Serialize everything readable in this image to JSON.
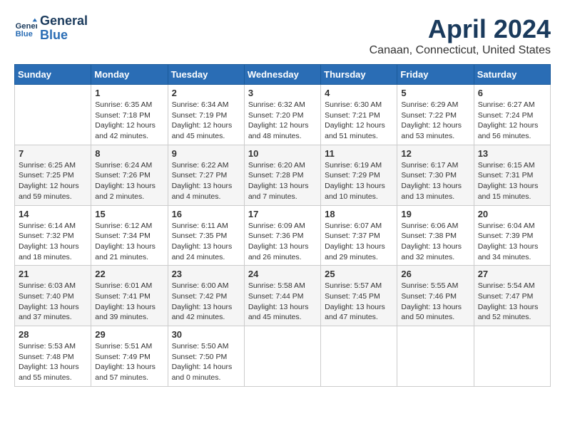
{
  "header": {
    "logo_line1": "General",
    "logo_line2": "Blue",
    "month": "April 2024",
    "location": "Canaan, Connecticut, United States"
  },
  "weekdays": [
    "Sunday",
    "Monday",
    "Tuesday",
    "Wednesday",
    "Thursday",
    "Friday",
    "Saturday"
  ],
  "weeks": [
    [
      {
        "day": "",
        "sunrise": "",
        "sunset": "",
        "daylight": ""
      },
      {
        "day": "1",
        "sunrise": "Sunrise: 6:35 AM",
        "sunset": "Sunset: 7:18 PM",
        "daylight": "Daylight: 12 hours and 42 minutes."
      },
      {
        "day": "2",
        "sunrise": "Sunrise: 6:34 AM",
        "sunset": "Sunset: 7:19 PM",
        "daylight": "Daylight: 12 hours and 45 minutes."
      },
      {
        "day": "3",
        "sunrise": "Sunrise: 6:32 AM",
        "sunset": "Sunset: 7:20 PM",
        "daylight": "Daylight: 12 hours and 48 minutes."
      },
      {
        "day": "4",
        "sunrise": "Sunrise: 6:30 AM",
        "sunset": "Sunset: 7:21 PM",
        "daylight": "Daylight: 12 hours and 51 minutes."
      },
      {
        "day": "5",
        "sunrise": "Sunrise: 6:29 AM",
        "sunset": "Sunset: 7:22 PM",
        "daylight": "Daylight: 12 hours and 53 minutes."
      },
      {
        "day": "6",
        "sunrise": "Sunrise: 6:27 AM",
        "sunset": "Sunset: 7:24 PM",
        "daylight": "Daylight: 12 hours and 56 minutes."
      }
    ],
    [
      {
        "day": "7",
        "sunrise": "Sunrise: 6:25 AM",
        "sunset": "Sunset: 7:25 PM",
        "daylight": "Daylight: 12 hours and 59 minutes."
      },
      {
        "day": "8",
        "sunrise": "Sunrise: 6:24 AM",
        "sunset": "Sunset: 7:26 PM",
        "daylight": "Daylight: 13 hours and 2 minutes."
      },
      {
        "day": "9",
        "sunrise": "Sunrise: 6:22 AM",
        "sunset": "Sunset: 7:27 PM",
        "daylight": "Daylight: 13 hours and 4 minutes."
      },
      {
        "day": "10",
        "sunrise": "Sunrise: 6:20 AM",
        "sunset": "Sunset: 7:28 PM",
        "daylight": "Daylight: 13 hours and 7 minutes."
      },
      {
        "day": "11",
        "sunrise": "Sunrise: 6:19 AM",
        "sunset": "Sunset: 7:29 PM",
        "daylight": "Daylight: 13 hours and 10 minutes."
      },
      {
        "day": "12",
        "sunrise": "Sunrise: 6:17 AM",
        "sunset": "Sunset: 7:30 PM",
        "daylight": "Daylight: 13 hours and 13 minutes."
      },
      {
        "day": "13",
        "sunrise": "Sunrise: 6:15 AM",
        "sunset": "Sunset: 7:31 PM",
        "daylight": "Daylight: 13 hours and 15 minutes."
      }
    ],
    [
      {
        "day": "14",
        "sunrise": "Sunrise: 6:14 AM",
        "sunset": "Sunset: 7:32 PM",
        "daylight": "Daylight: 13 hours and 18 minutes."
      },
      {
        "day": "15",
        "sunrise": "Sunrise: 6:12 AM",
        "sunset": "Sunset: 7:34 PM",
        "daylight": "Daylight: 13 hours and 21 minutes."
      },
      {
        "day": "16",
        "sunrise": "Sunrise: 6:11 AM",
        "sunset": "Sunset: 7:35 PM",
        "daylight": "Daylight: 13 hours and 24 minutes."
      },
      {
        "day": "17",
        "sunrise": "Sunrise: 6:09 AM",
        "sunset": "Sunset: 7:36 PM",
        "daylight": "Daylight: 13 hours and 26 minutes."
      },
      {
        "day": "18",
        "sunrise": "Sunrise: 6:07 AM",
        "sunset": "Sunset: 7:37 PM",
        "daylight": "Daylight: 13 hours and 29 minutes."
      },
      {
        "day": "19",
        "sunrise": "Sunrise: 6:06 AM",
        "sunset": "Sunset: 7:38 PM",
        "daylight": "Daylight: 13 hours and 32 minutes."
      },
      {
        "day": "20",
        "sunrise": "Sunrise: 6:04 AM",
        "sunset": "Sunset: 7:39 PM",
        "daylight": "Daylight: 13 hours and 34 minutes."
      }
    ],
    [
      {
        "day": "21",
        "sunrise": "Sunrise: 6:03 AM",
        "sunset": "Sunset: 7:40 PM",
        "daylight": "Daylight: 13 hours and 37 minutes."
      },
      {
        "day": "22",
        "sunrise": "Sunrise: 6:01 AM",
        "sunset": "Sunset: 7:41 PM",
        "daylight": "Daylight: 13 hours and 39 minutes."
      },
      {
        "day": "23",
        "sunrise": "Sunrise: 6:00 AM",
        "sunset": "Sunset: 7:42 PM",
        "daylight": "Daylight: 13 hours and 42 minutes."
      },
      {
        "day": "24",
        "sunrise": "Sunrise: 5:58 AM",
        "sunset": "Sunset: 7:44 PM",
        "daylight": "Daylight: 13 hours and 45 minutes."
      },
      {
        "day": "25",
        "sunrise": "Sunrise: 5:57 AM",
        "sunset": "Sunset: 7:45 PM",
        "daylight": "Daylight: 13 hours and 47 minutes."
      },
      {
        "day": "26",
        "sunrise": "Sunrise: 5:55 AM",
        "sunset": "Sunset: 7:46 PM",
        "daylight": "Daylight: 13 hours and 50 minutes."
      },
      {
        "day": "27",
        "sunrise": "Sunrise: 5:54 AM",
        "sunset": "Sunset: 7:47 PM",
        "daylight": "Daylight: 13 hours and 52 minutes."
      }
    ],
    [
      {
        "day": "28",
        "sunrise": "Sunrise: 5:53 AM",
        "sunset": "Sunset: 7:48 PM",
        "daylight": "Daylight: 13 hours and 55 minutes."
      },
      {
        "day": "29",
        "sunrise": "Sunrise: 5:51 AM",
        "sunset": "Sunset: 7:49 PM",
        "daylight": "Daylight: 13 hours and 57 minutes."
      },
      {
        "day": "30",
        "sunrise": "Sunrise: 5:50 AM",
        "sunset": "Sunset: 7:50 PM",
        "daylight": "Daylight: 14 hours and 0 minutes."
      },
      {
        "day": "",
        "sunrise": "",
        "sunset": "",
        "daylight": ""
      },
      {
        "day": "",
        "sunrise": "",
        "sunset": "",
        "daylight": ""
      },
      {
        "day": "",
        "sunrise": "",
        "sunset": "",
        "daylight": ""
      },
      {
        "day": "",
        "sunrise": "",
        "sunset": "",
        "daylight": ""
      }
    ]
  ]
}
